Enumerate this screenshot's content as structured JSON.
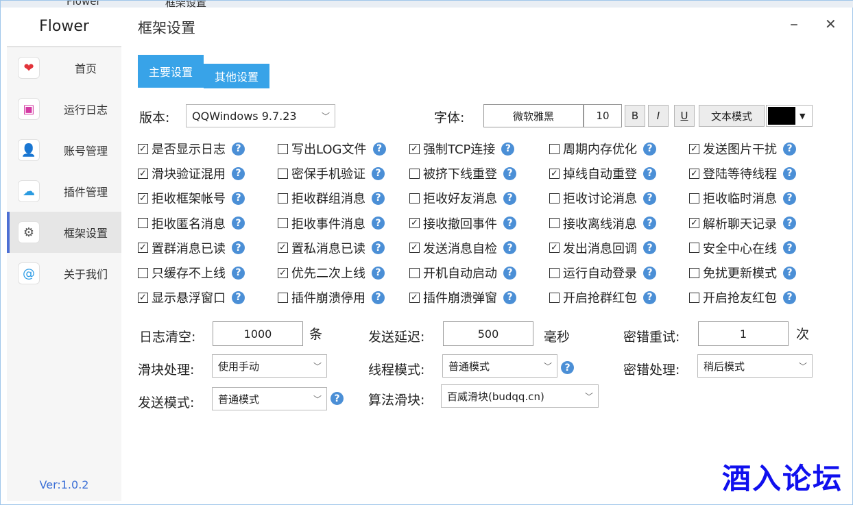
{
  "background_window": {
    "title_left": "Flower",
    "title_right": "框架设置"
  },
  "app": {
    "name": "Flower",
    "version": "Ver:1.0.2"
  },
  "sidebar": {
    "items": [
      {
        "label": "首页",
        "icon": "heart-icon",
        "icon_color": "#e2333a",
        "glyph": "❤",
        "active": false
      },
      {
        "label": "运行日志",
        "icon": "bookmark-icon",
        "icon_color": "#d43aa3",
        "glyph": "▣",
        "active": false
      },
      {
        "label": "账号管理",
        "icon": "user-icon",
        "icon_color": "#222222",
        "glyph": "👤",
        "active": false
      },
      {
        "label": "插件管理",
        "icon": "cloud-icon",
        "icon_color": "#2b9be0",
        "glyph": "☁",
        "active": false
      },
      {
        "label": "框架设置",
        "icon": "gear-icon",
        "icon_color": "#555555",
        "glyph": "⚙",
        "active": true
      },
      {
        "label": "关于我们",
        "icon": "at-sign-icon",
        "icon_color": "#2d9ce6",
        "glyph": "@",
        "active": false
      }
    ]
  },
  "header": {
    "title": "框架设置",
    "minimize": "–",
    "close": "✕"
  },
  "tabs": [
    {
      "label": "主要设置",
      "active": true
    },
    {
      "label": "其他设置",
      "active": false
    }
  ],
  "version_row": {
    "label": "版本:",
    "value": "QQWindows 9.7.23"
  },
  "font_row": {
    "label": "字体:",
    "font_name": "微软雅黑",
    "font_size": "10",
    "bold": "B",
    "italic": "I",
    "underline": "U",
    "mode_button": "文本模式",
    "color": "#000000"
  },
  "checkboxes": [
    [
      {
        "label": "是否显示日志",
        "checked": true
      },
      {
        "label": "写出LOG文件",
        "checked": false
      },
      {
        "label": "强制TCP连接",
        "checked": true
      },
      {
        "label": "周期内存优化",
        "checked": false
      },
      {
        "label": "发送图片干扰",
        "checked": true
      }
    ],
    [
      {
        "label": "滑块验证混用",
        "checked": true
      },
      {
        "label": "密保手机验证",
        "checked": false
      },
      {
        "label": "被挤下线重登",
        "checked": false
      },
      {
        "label": "掉线自动重登",
        "checked": true
      },
      {
        "label": "登陆等待线程",
        "checked": true
      }
    ],
    [
      {
        "label": "拒收框架帐号",
        "checked": true
      },
      {
        "label": "拒收群组消息",
        "checked": false
      },
      {
        "label": "拒收好友消息",
        "checked": false
      },
      {
        "label": "拒收讨论消息",
        "checked": false
      },
      {
        "label": "拒收临时消息",
        "checked": false
      }
    ],
    [
      {
        "label": "拒收匿名消息",
        "checked": false
      },
      {
        "label": "拒收事件消息",
        "checked": false
      },
      {
        "label": "接收撤回事件",
        "checked": true
      },
      {
        "label": "接收离线消息",
        "checked": false
      },
      {
        "label": "解析聊天记录",
        "checked": true
      }
    ],
    [
      {
        "label": "置群消息已读",
        "checked": true
      },
      {
        "label": "置私消息已读",
        "checked": true
      },
      {
        "label": "发送消息自检",
        "checked": true
      },
      {
        "label": "发出消息回调",
        "checked": true
      },
      {
        "label": "安全中心在线",
        "checked": false
      }
    ],
    [
      {
        "label": "只缓存不上线",
        "checked": false
      },
      {
        "label": "优先二次上线",
        "checked": true
      },
      {
        "label": "开机自动启动",
        "checked": false
      },
      {
        "label": "运行自动登录",
        "checked": false
      },
      {
        "label": "免扰更新模式",
        "checked": false
      }
    ],
    [
      {
        "label": "显示悬浮窗口",
        "checked": true
      },
      {
        "label": "插件崩溃停用",
        "checked": false
      },
      {
        "label": "插件崩溃弹窗",
        "checked": true
      },
      {
        "label": "开启抢群红包",
        "checked": false
      },
      {
        "label": "开启抢友红包",
        "checked": false
      }
    ]
  ],
  "help_glyph": "?",
  "check_glyph": "✓",
  "settings": {
    "log_clear": {
      "label": "日志清空:",
      "value": "1000",
      "unit": "条"
    },
    "send_delay": {
      "label": "发送延迟:",
      "value": "500",
      "unit": "毫秒"
    },
    "pwd_retry": {
      "label": "密错重试:",
      "value": "1",
      "unit": "次"
    },
    "slider_handling": {
      "label": "滑块处理:",
      "value": "使用手动"
    },
    "thread_mode": {
      "label": "线程模式:",
      "value": "普通模式"
    },
    "pwd_handling": {
      "label": "密错处理:",
      "value": "稍后模式"
    },
    "send_mode": {
      "label": "发送模式:",
      "value": "普通模式"
    },
    "algo_slider": {
      "label": "算法滑块:",
      "value": "百威滑块(budqq.cn)"
    }
  },
  "watermark": "酒入论坛",
  "colors": {
    "accent": "#38a3e8",
    "help": "#4b8fd6",
    "version_text": "#3b6fd6",
    "watermark": "#1010ee"
  }
}
